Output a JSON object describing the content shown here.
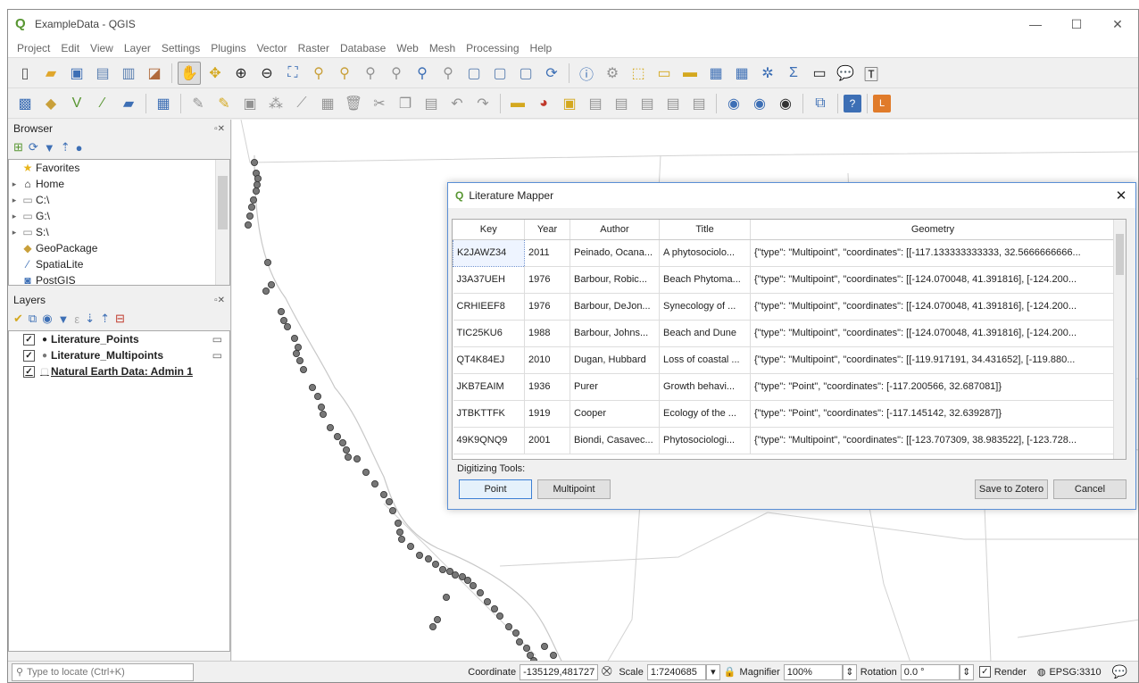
{
  "window": {
    "title": "ExampleData - QGIS",
    "controls": [
      "—",
      "☐",
      "✕"
    ]
  },
  "menu": [
    "Project",
    "Edit",
    "View",
    "Layer",
    "Settings",
    "Plugins",
    "Vector",
    "Raster",
    "Database",
    "Web",
    "Mesh",
    "Processing",
    "Help"
  ],
  "browser": {
    "title": "Browser",
    "items": [
      {
        "label": "Favorites",
        "icon": "star-icon"
      },
      {
        "label": "Home",
        "icon": "home-folder-icon"
      },
      {
        "label": "C:\\",
        "icon": "folder-icon"
      },
      {
        "label": "G:\\",
        "icon": "folder-icon"
      },
      {
        "label": "S:\\",
        "icon": "folder-icon"
      },
      {
        "label": "GeoPackage",
        "icon": "geopackage-icon"
      },
      {
        "label": "SpatiaLite",
        "icon": "spatialite-icon"
      },
      {
        "label": "PostGIS",
        "icon": "postgis-icon"
      }
    ]
  },
  "layers": {
    "title": "Layers",
    "items": [
      {
        "label": "Literature_Points"
      },
      {
        "label": "Literature_Multipoints"
      },
      {
        "label": "Natural Earth Data: Admin 1"
      }
    ]
  },
  "dialog": {
    "title": "Literature Mapper",
    "headers": [
      "Key",
      "Year",
      "Author",
      "Title",
      "Geometry"
    ],
    "rows": [
      [
        "K2JAWZ34",
        "2011",
        "Peinado, Ocana...",
        "A phytosociolo...",
        "{\"type\": \"Multipoint\", \"coordinates\": [[-117.133333333333, 32.5666666666..."
      ],
      [
        "J3A37UEH",
        "1976",
        "Barbour, Robic...",
        "Beach Phytoma...",
        "{\"type\": \"Multipoint\", \"coordinates\": [[-124.070048, 41.391816], [-124.200..."
      ],
      [
        "CRHIEEF8",
        "1976",
        "Barbour, DeJon...",
        "Synecology of ...",
        "{\"type\": \"Multipoint\", \"coordinates\": [[-124.070048, 41.391816], [-124.200..."
      ],
      [
        "TIC25KU6",
        "1988",
        "Barbour, Johns...",
        "Beach and Dune",
        "{\"type\": \"Multipoint\", \"coordinates\": [[-124.070048, 41.391816], [-124.200..."
      ],
      [
        "QT4K84EJ",
        "2010",
        "Dugan, Hubbard",
        "Loss of coastal ...",
        "{\"type\": \"Multipoint\", \"coordinates\": [[-119.917191, 34.431652], [-119.880..."
      ],
      [
        "JKB7EAIM",
        "1936",
        "Purer",
        "Growth behavi...",
        "{\"type\": \"Point\", \"coordinates\": [-117.200566, 32.687081]}"
      ],
      [
        "JTBKTTFK",
        "1919",
        "Cooper",
        "Ecology of the ...",
        "{\"type\": \"Point\", \"coordinates\": [-117.145142, 32.639287]}"
      ],
      [
        "49K9QNQ9",
        "2001",
        "Biondi, Casavec...",
        "Phytosociologi...",
        "{\"type\": \"Multipoint\", \"coordinates\": [[-123.707309, 38.983522], [-123.728..."
      ]
    ],
    "digitizing_label": "Digitizing Tools:",
    "point_label": "Point",
    "multipoint_label": "Multipoint",
    "save_label": "Save to Zotero",
    "cancel_label": "Cancel"
  },
  "status": {
    "locate_placeholder": "Type to locate (Ctrl+K)",
    "coordinate_label": "Coordinate",
    "coordinate_value": "-135129,481727",
    "scale_label": "Scale",
    "scale_value": "1:7240685",
    "magnifier_label": "Magnifier",
    "magnifier_value": "100%",
    "rotation_label": "Rotation",
    "rotation_value": "0.0 °",
    "render_label": "Render",
    "crs_label": "EPSG:3310"
  }
}
